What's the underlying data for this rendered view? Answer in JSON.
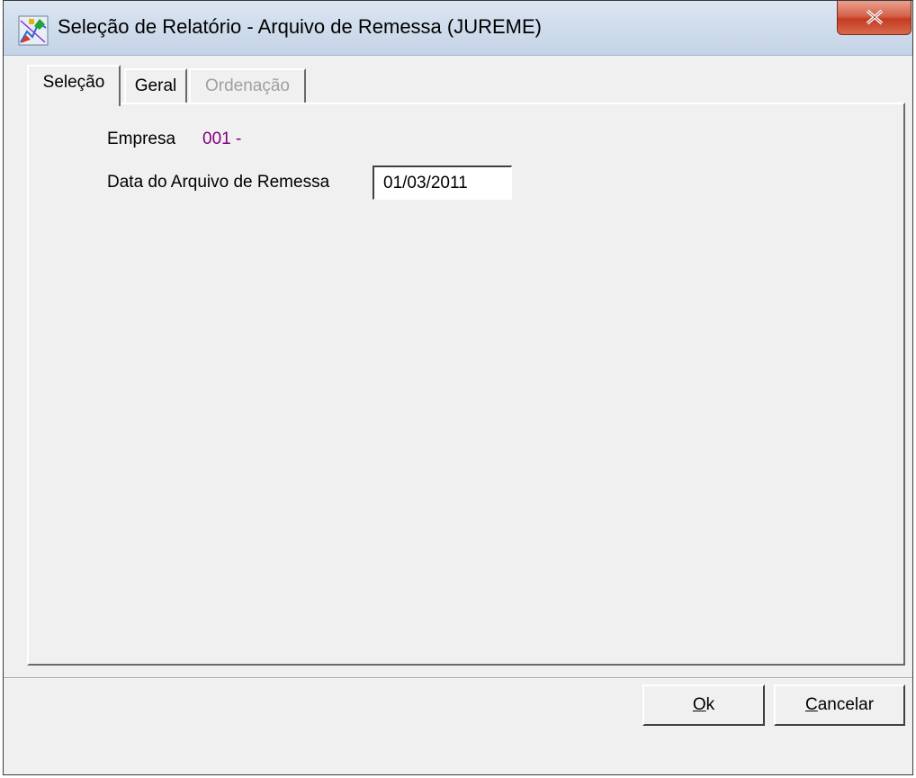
{
  "window": {
    "title": "Seleção de Relatório - Arquivo de Remessa (JUREME)",
    "icon": "report-selection-icon",
    "close_icon": "close-icon",
    "close_color": "#c43c22"
  },
  "tabs": [
    {
      "label": "Seleção",
      "active": true,
      "enabled": true
    },
    {
      "label": "Geral",
      "active": false,
      "enabled": true
    },
    {
      "label": "Ordenação",
      "active": false,
      "enabled": false
    }
  ],
  "form": {
    "empresa_label": "Empresa",
    "empresa_value": "001 -",
    "empresa_value_color": "#800080",
    "data_label": "Data do Arquivo de Remessa",
    "data_value": "01/03/2011"
  },
  "buttons": {
    "ok": {
      "mnemonic": "O",
      "rest": "k"
    },
    "cancel": {
      "mnemonic": "C",
      "rest": "ancelar"
    }
  }
}
